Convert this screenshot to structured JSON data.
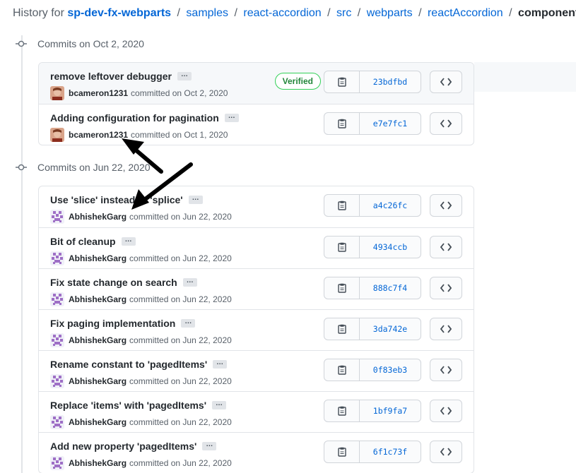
{
  "breadcrumb": {
    "prefix": "History for",
    "repo": "sp-dev-fx-webparts",
    "segments": [
      "samples",
      "react-accordion",
      "src",
      "webparts",
      "reactAccordion"
    ],
    "current": "components",
    "separator": "/"
  },
  "groups": [
    {
      "label": "Commits on Oct 2, 2020",
      "commits": [
        {
          "message": "remove leftover debugger",
          "author": "bcameron1231",
          "committed_text": "committed on Oct 2, 2020",
          "sha": "23bdfbd",
          "verified": "Verified",
          "avatar": "photo"
        },
        {
          "message": "Adding configuration for pagination",
          "author": "bcameron1231",
          "committed_text": "committed on Oct 1, 2020",
          "sha": "e7e7fc1",
          "avatar": "photo"
        }
      ]
    },
    {
      "label": "Commits on Jun 22, 2020",
      "commits": [
        {
          "message": "Use 'slice' instead of 'splice'",
          "author": "AbhishekGarg",
          "committed_text": "committed on Jun 22, 2020",
          "sha": "a4c26fc",
          "avatar": "identicon"
        },
        {
          "message": "Bit of cleanup",
          "author": "AbhishekGarg",
          "committed_text": "committed on Jun 22, 2020",
          "sha": "4934ccb",
          "avatar": "identicon"
        },
        {
          "message": "Fix state change on search",
          "author": "AbhishekGarg",
          "committed_text": "committed on Jun 22, 2020",
          "sha": "888c7f4",
          "avatar": "identicon"
        },
        {
          "message": "Fix paging implementation",
          "author": "AbhishekGarg",
          "committed_text": "committed on Jun 22, 2020",
          "sha": "3da742e",
          "avatar": "identicon"
        },
        {
          "message": "Rename constant to 'pagedItems'",
          "author": "AbhishekGarg",
          "committed_text": "committed on Jun 22, 2020",
          "sha": "0f83eb3",
          "avatar": "identicon"
        },
        {
          "message": "Replace 'items' with 'pagedItems'",
          "author": "AbhishekGarg",
          "committed_text": "committed on Jun 22, 2020",
          "sha": "1bf9fa7",
          "avatar": "identicon"
        },
        {
          "message": "Add new property 'pagedItems'",
          "author": "AbhishekGarg",
          "committed_text": "committed on Jun 22, 2020",
          "sha": "6f1c73f",
          "avatar": "identicon"
        }
      ]
    }
  ],
  "ellipsis_label": "…",
  "icons": {
    "commit_node": "git-commit-icon",
    "copy": "clipboard-icon",
    "browse": "code-icon"
  },
  "colors": {
    "link": "#0366d6",
    "verified": "#22863a",
    "border": "#e1e4e8"
  }
}
